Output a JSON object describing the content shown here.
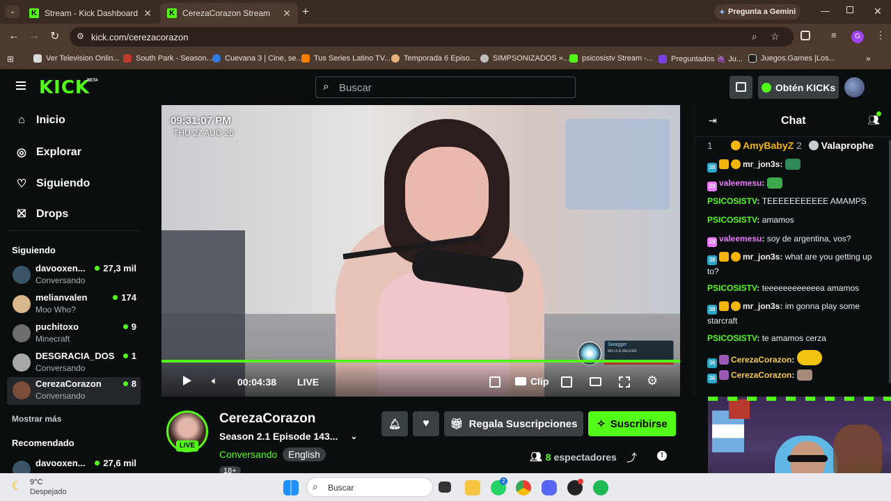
{
  "browser": {
    "tabs": [
      {
        "title": "Stream - Kick Dashboard"
      },
      {
        "title": "CerezaCorazon Stream - W"
      }
    ],
    "gemini_button": "Pregunta a Gemini",
    "url": "kick.com/cerezacorazon",
    "profile_initial": "G",
    "bookmarks": [
      {
        "label": "Ver Television Onlin...",
        "color": "#d9d9d9"
      },
      {
        "label": "South Park - Season...",
        "color": "#c0392b"
      },
      {
        "label": "Cuevana 3 | Cine, se...",
        "color": "#2f7de1"
      },
      {
        "label": "Tus Series Latino TV...",
        "color": "#f57c00"
      },
      {
        "label": "Temporada 6 Episo...",
        "color": "#e6b17a"
      },
      {
        "label": "SIMPSONIZADOS »...",
        "color": "#bdbdbd"
      },
      {
        "label": "psicosistv Stream -...",
        "color": "#53fc18"
      },
      {
        "label": "Preguntados 🍇 Ju...",
        "color": "#7b3fe4"
      },
      {
        "label": "Juegos.Games |Los...",
        "color": "#222222"
      }
    ]
  },
  "kick": {
    "logo": "KICK",
    "beta": "BETA",
    "search_placeholder": "Buscar",
    "get_kicks": "Obtén KICKs",
    "nav": [
      {
        "label": "Inicio",
        "icon": "home-icon"
      },
      {
        "label": "Explorar",
        "icon": "compass-icon"
      },
      {
        "label": "Siguiendo",
        "icon": "heart-icon"
      },
      {
        "label": "Drops",
        "icon": "gift-icon"
      }
    ],
    "following_title": "Siguiendo",
    "following": [
      {
        "name": "davooxen...",
        "sub": "Conversando",
        "viewers": "27,3 mil",
        "color": "#3a5468"
      },
      {
        "name": "melianvalen",
        "sub": "Moo Who?",
        "viewers": "174",
        "color": "#d8b78c"
      },
      {
        "name": "puchitoxo",
        "sub": "Minecraft",
        "viewers": "9",
        "color": "#6d6d6d"
      },
      {
        "name": "DESGRACIA_DOS",
        "sub": "Conversando",
        "viewers": "1",
        "color": "#a8a8a8"
      },
      {
        "name": "CerezaCorazon",
        "sub": "Conversando",
        "viewers": "8",
        "color": "#7a4e3a"
      }
    ],
    "show_more": "Mostrar más",
    "recommended_title": "Recomendado",
    "recommended": [
      {
        "name": "davooxen...",
        "viewers": "27,6 mil",
        "color": "#3a5468"
      }
    ]
  },
  "video": {
    "clock_time": "09:31:07 PM",
    "clock_date": "THU 27 AUG 26",
    "overlay_title": "Swagger",
    "overlay_sub": "MILLS & WELKER",
    "elapsed": "00:04:38",
    "live_label": "LIVE",
    "clip_label": "Clip"
  },
  "channel": {
    "name": "CerezaCorazon",
    "title": "Season 2.1 Episode 143...",
    "category": "Conversando",
    "language_tag": "English",
    "age_tag": "18+",
    "avatar_live": "LIVE",
    "gift_subs": "Regala Suscripciones",
    "subscribe": "Suscribirse",
    "viewers_count": "8",
    "viewers_label": "espectadores"
  },
  "chat": {
    "title": "Chat",
    "leaderboard": [
      {
        "rank": "1",
        "name": "AmyBabyZ",
        "count": "2"
      },
      {
        "rank": "2",
        "name": "Valaprophe"
      }
    ],
    "messages": [
      {
        "user": "mr_jon3s",
        "color": "#f2f2f2",
        "badges": [
          "38",
          "crown",
          "1"
        ],
        "text": "",
        "emote": "#2e8b57"
      },
      {
        "user": "valeemesu",
        "color": "#e879f9",
        "badges": [
          "29"
        ],
        "text": "",
        "emote": "#3aa84b"
      },
      {
        "user": "PSICOSISTV",
        "color": "#53fc18",
        "badges": [],
        "text": "TEEEEEEEEEEE AMAMPS"
      },
      {
        "user": "PSICOSISTV",
        "color": "#53fc18",
        "badges": [],
        "text": "amamos"
      },
      {
        "user": "valeemesu",
        "color": "#e879f9",
        "badges": [
          "29"
        ],
        "text": "soy de argentina, vos?"
      },
      {
        "user": "mr_jon3s",
        "color": "#f2f2f2",
        "badges": [
          "38",
          "crown",
          "1"
        ],
        "text": "what are you getting up to?"
      },
      {
        "user": "PSICOSISTV",
        "color": "#53fc18",
        "badges": [],
        "text": "teeeeeeeeeeeea amamos"
      },
      {
        "user": "mr_jon3s",
        "color": "#f2f2f2",
        "badges": [
          "38",
          "crown",
          "1"
        ],
        "text": "im gonna play some starcraft"
      },
      {
        "user": "PSICOSISTV",
        "color": "#53fc18",
        "badges": [],
        "text": "te amamos cerza"
      },
      {
        "user": "CerezaCorazon",
        "color": "#f7c948",
        "badges": [
          "36",
          "mic"
        ],
        "text": "",
        "emote": "#f1c40f"
      },
      {
        "user": "CerezaCorazon",
        "color": "#f7c948",
        "badges": [
          "36",
          "mic"
        ],
        "text": "",
        "emote": "#a58b7a"
      }
    ]
  },
  "taskbar": {
    "weather_temp": "9°C",
    "weather_desc": "Despejado",
    "search_label": "Buscar",
    "whatsapp_badge": "2"
  },
  "colors": {
    "kick_green": "#53fc18",
    "bg": "#0b0e0f",
    "panel": "#24272c"
  }
}
